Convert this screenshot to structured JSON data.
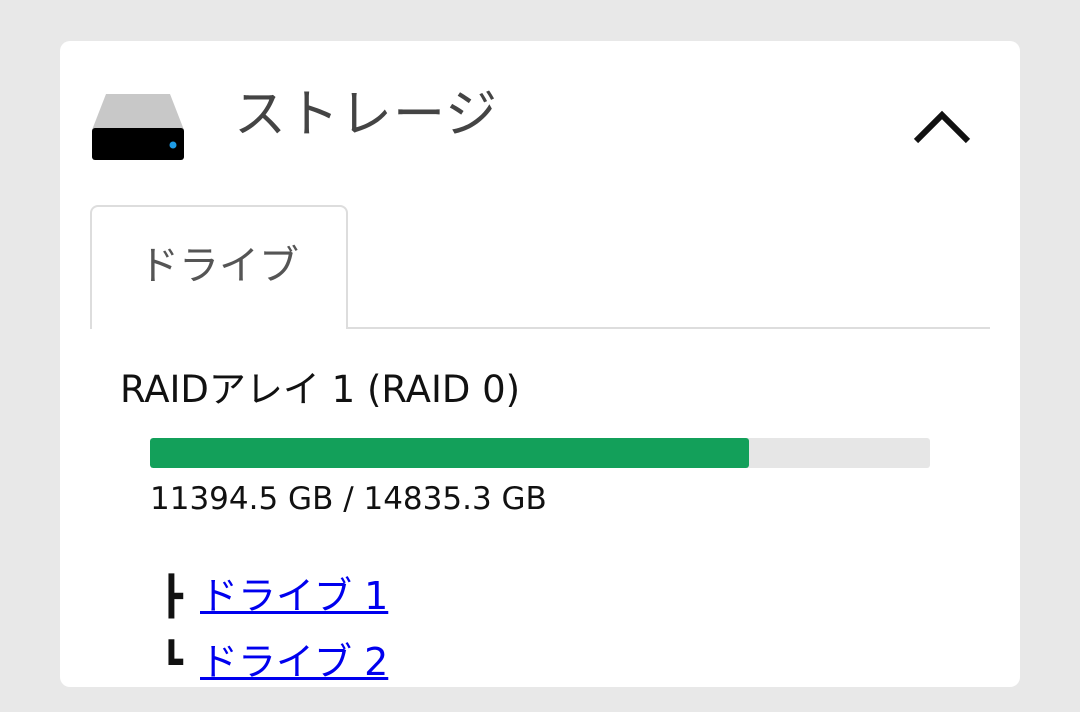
{
  "panel": {
    "title": "ストレージ",
    "icon": "hard-drive-icon",
    "collapse_icon": "chevron-up-icon"
  },
  "tabs": [
    {
      "label": "ドライブ"
    }
  ],
  "raid": {
    "name": "RAIDアレイ 1 (RAID 0)",
    "used_gb": 11394.5,
    "total_gb": 14835.3,
    "usage_fraction": 0.768,
    "capacity_text": "11394.5 GB / 14835.3 GB",
    "bar_color": "#13a05a",
    "drives": [
      {
        "tree_glyph": "┣",
        "label": "ドライブ 1"
      },
      {
        "tree_glyph": "┗",
        "label": "ドライブ 2"
      }
    ]
  }
}
